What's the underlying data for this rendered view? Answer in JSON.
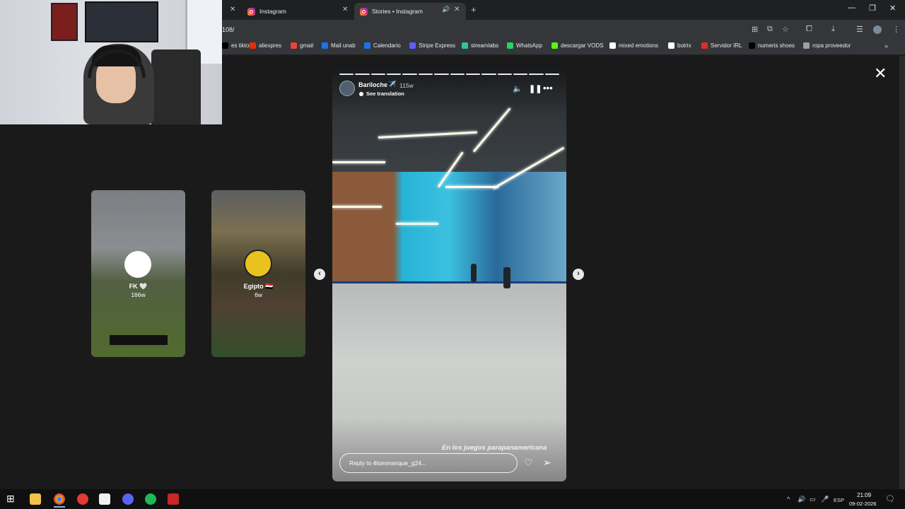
{
  "browser": {
    "tabs": [
      {
        "title": "Instagram"
      },
      {
        "title": "Stories • Instagram"
      }
    ],
    "url_fragment": "108/",
    "bookmarks": [
      {
        "label": "es tiktok",
        "color": "#000000"
      },
      {
        "label": "aliexpres",
        "color": "#e62e04"
      },
      {
        "label": "gmail",
        "color": "#ea4335"
      },
      {
        "label": "Mail unab",
        "color": "#1a73e8"
      },
      {
        "label": "Calendario",
        "color": "#1a73e8"
      },
      {
        "label": "Stripe Express",
        "color": "#635bff"
      },
      {
        "label": "streamlabs",
        "color": "#31c3a2"
      },
      {
        "label": "WhatsApp",
        "color": "#25d366"
      },
      {
        "label": "descargar VODS",
        "color": "#53fc18"
      },
      {
        "label": "mixed emotions",
        "color": "#ffffff"
      },
      {
        "label": "botrix",
        "color": "#ffffff"
      },
      {
        "label": "Servidor IRL",
        "color": "#d93025"
      },
      {
        "label": "numeris shoes",
        "color": "#000000"
      },
      {
        "label": "ropa proveedor",
        "color": "#9aa0a6"
      }
    ]
  },
  "stories": {
    "previews": [
      {
        "name": "FK 🤍",
        "time": "166w"
      },
      {
        "name": "Egipto 🇪🇬",
        "time": "6w"
      }
    ],
    "current": {
      "username": "Bariloche",
      "plane": "✈️",
      "time": "115w",
      "see_translation": "See translation",
      "caption": "En los juegos parapanamericana",
      "reply_placeholder": "Reply to 4tommanque_g24..."
    }
  },
  "taskbar": {
    "lang": "ESP",
    "time": "21:09",
    "date": "09-02-2026"
  }
}
